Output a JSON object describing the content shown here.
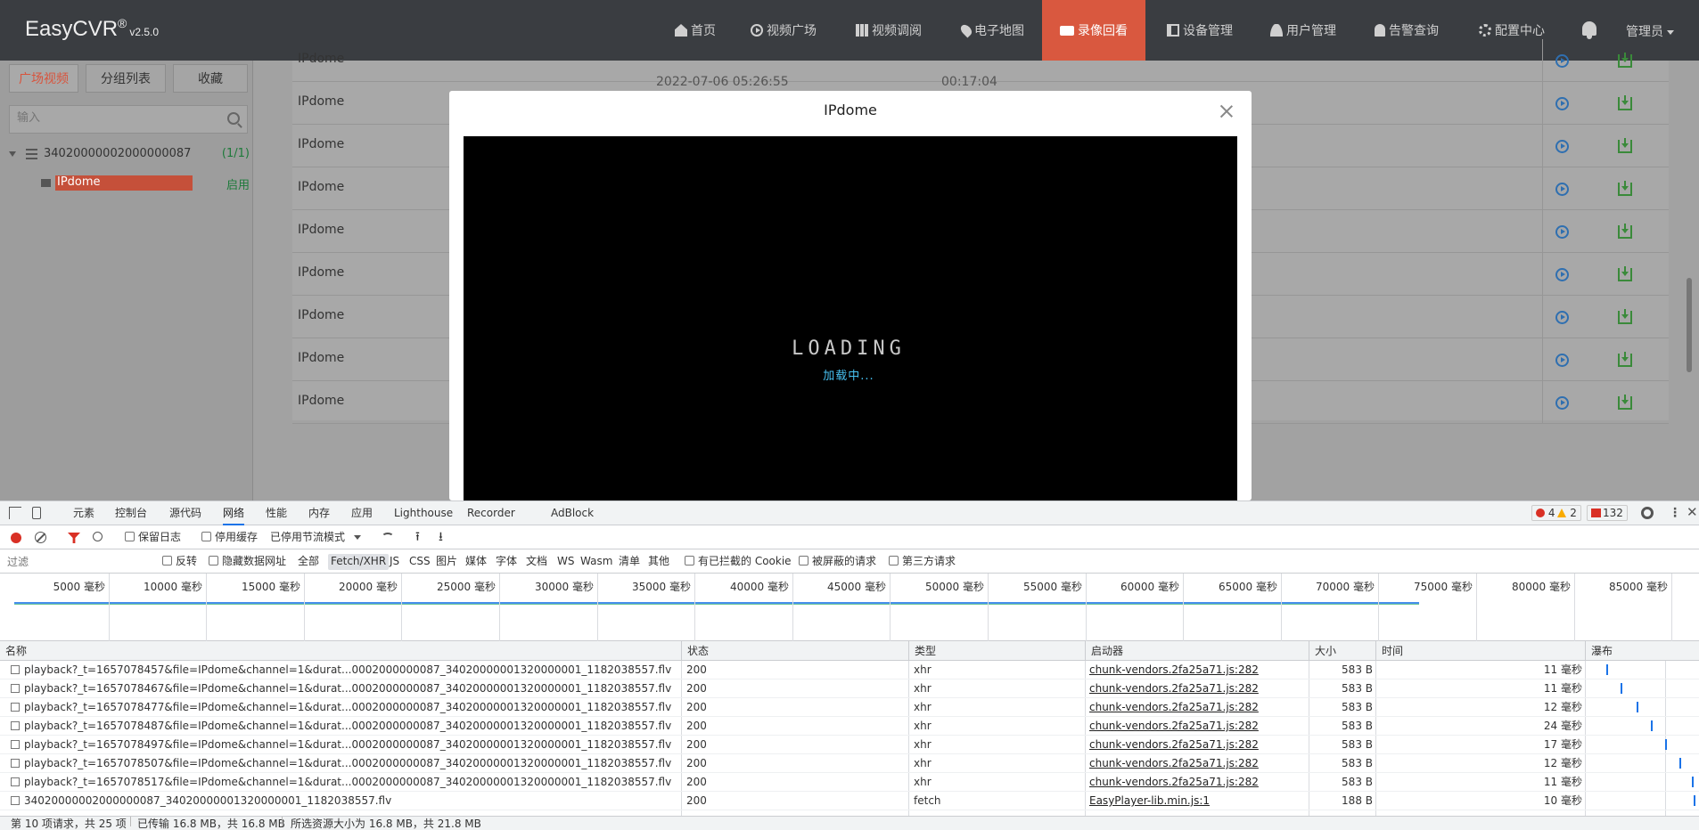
{
  "app": {
    "logo": "EasyCVR",
    "logo_mark": "®",
    "version": "v2.5.0",
    "nav": [
      {
        "label": "首页",
        "icon": "home-icon"
      },
      {
        "label": "视频广场",
        "icon": "play-circle-icon"
      },
      {
        "label": "视频调阅",
        "icon": "grid-icon"
      },
      {
        "label": "电子地图",
        "icon": "map-pin-icon"
      },
      {
        "label": "录像回看",
        "icon": "video-camera-icon",
        "active": true
      },
      {
        "label": "设备管理",
        "icon": "book-icon"
      },
      {
        "label": "用户管理",
        "icon": "user-icon"
      },
      {
        "label": "告警查询",
        "icon": "alarm-icon"
      },
      {
        "label": "配置中心",
        "icon": "gear-icon"
      }
    ],
    "user": "管理员",
    "accent": "#d9583f"
  },
  "sidebar": {
    "tabs": [
      "广场视频",
      "分组列表",
      "收藏"
    ],
    "search_placeholder": "输入",
    "device": {
      "id": "34020000002000000087",
      "count": "(1/1)"
    },
    "channel": {
      "name": "IPdome",
      "status": "启用"
    }
  },
  "records": {
    "ghost_time": "2022-07-06 05:26:55",
    "ghost_duration": "00:17:04",
    "rows": [
      "IPdome",
      "IPdome",
      "IPdome",
      "IPdome",
      "IPdome",
      "IPdome",
      "IPdome",
      "IPdome",
      "IPdome",
      "IPdome"
    ]
  },
  "modal": {
    "title": "IPdome",
    "spinner": "LOADING",
    "loading": "加载中..."
  },
  "devtools": {
    "tabs": [
      "元素",
      "控制台",
      "源代码",
      "网络",
      "性能",
      "内存",
      "应用",
      "Lighthouse",
      "Recorder",
      "AdBlock"
    ],
    "active_tab": "网络",
    "errors": "4",
    "warnings": "2",
    "issues": "132",
    "toolbar": {
      "preserve_log": "保留日志",
      "disable_cache": "停用缓存",
      "throttle": "已停用节流模式"
    },
    "filter": {
      "placeholder": "过滤",
      "invert": "反转",
      "hide_data_urls": "隐藏数据网址",
      "types": [
        "全部",
        "Fetch/XHR",
        "JS",
        "CSS",
        "图片",
        "媒体",
        "字体",
        "文档",
        "WS",
        "Wasm",
        "清单",
        "其他"
      ],
      "selected_type": "Fetch/XHR",
      "blocked_cookies": "有已拦截的 Cookie",
      "blocked_requests": "被屏蔽的请求",
      "third_party": "第三方请求"
    },
    "timeline_ticks": [
      "5000 毫秒",
      "10000 毫秒",
      "15000 毫秒",
      "20000 毫秒",
      "25000 毫秒",
      "30000 毫秒",
      "35000 毫秒",
      "40000 毫秒",
      "45000 毫秒",
      "50000 毫秒",
      "55000 毫秒",
      "60000 毫秒",
      "65000 毫秒",
      "70000 毫秒",
      "75000 毫秒",
      "80000 毫秒",
      "85000 毫秒"
    ],
    "columns": [
      "名称",
      "状态",
      "类型",
      "启动器",
      "大小",
      "时间",
      "瀑布"
    ],
    "requests": [
      {
        "name": "playback?_t=1657078457&file=IPdome&channel=1&durat...0002000000087_34020000001320000001_1182038557.flv",
        "status": "200",
        "type": "xhr",
        "initiator": "chunk-vendors.2fa25a71.js:282",
        "size": "583 B",
        "time": "11 毫秒"
      },
      {
        "name": "playback?_t=1657078467&file=IPdome&channel=1&durat...0002000000087_34020000001320000001_1182038557.flv",
        "status": "200",
        "type": "xhr",
        "initiator": "chunk-vendors.2fa25a71.js:282",
        "size": "583 B",
        "time": "11 毫秒"
      },
      {
        "name": "playback?_t=1657078477&file=IPdome&channel=1&durat...0002000000087_34020000001320000001_1182038557.flv",
        "status": "200",
        "type": "xhr",
        "initiator": "chunk-vendors.2fa25a71.js:282",
        "size": "583 B",
        "time": "12 毫秒"
      },
      {
        "name": "playback?_t=1657078487&file=IPdome&channel=1&durat...0002000000087_34020000001320000001_1182038557.flv",
        "status": "200",
        "type": "xhr",
        "initiator": "chunk-vendors.2fa25a71.js:282",
        "size": "583 B",
        "time": "24 毫秒"
      },
      {
        "name": "playback?_t=1657078497&file=IPdome&channel=1&durat...0002000000087_34020000001320000001_1182038557.flv",
        "status": "200",
        "type": "xhr",
        "initiator": "chunk-vendors.2fa25a71.js:282",
        "size": "583 B",
        "time": "17 毫秒"
      },
      {
        "name": "playback?_t=1657078507&file=IPdome&channel=1&durat...0002000000087_34020000001320000001_1182038557.flv",
        "status": "200",
        "type": "xhr",
        "initiator": "chunk-vendors.2fa25a71.js:282",
        "size": "583 B",
        "time": "12 毫秒"
      },
      {
        "name": "playback?_t=1657078517&file=IPdome&channel=1&durat...0002000000087_34020000001320000001_1182038557.flv",
        "status": "200",
        "type": "xhr",
        "initiator": "chunk-vendors.2fa25a71.js:282",
        "size": "583 B",
        "time": "11 毫秒"
      },
      {
        "name": "34020000002000000087_34020000001320000001_1182038557.flv",
        "status": "200",
        "type": "fetch",
        "initiator": "EasyPlayer-lib.min.js:1",
        "size": "188 B",
        "time": "10 毫秒"
      }
    ],
    "status": {
      "requests": "第 10 项请求，共 25 项",
      "transferred": "已传输 16.8 MB，共 16.8 MB",
      "resources": "所选资源大小为 16.8 MB，共 21.8 MB"
    }
  }
}
